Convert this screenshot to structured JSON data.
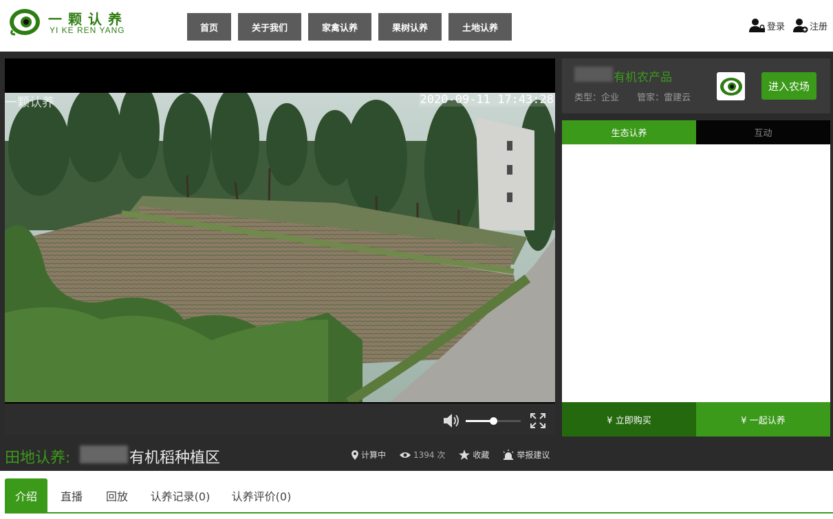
{
  "header": {
    "logo_cn": "一颗认养",
    "logo_en": "YI KE REN YANG",
    "nav": [
      "首页",
      "关于我们",
      "家禽认养",
      "果树认养",
      "土地认养"
    ],
    "login": "登录",
    "register": "注册"
  },
  "video": {
    "osd_watermark": "一颗认养",
    "osd_timestamp": "2020-09-11 17:43:28",
    "volume_level": 0.5
  },
  "farm": {
    "name": "有机农产品",
    "type": "类型：企业",
    "manager": "管家：雷建云",
    "enter_button": "进入农场"
  },
  "side_tabs": [
    "生态认养",
    "互动"
  ],
  "buy": {
    "buy_now": "¥ 立即购买",
    "adopt_together": "¥ 一起认养"
  },
  "title": {
    "category": "田地认养:",
    "name": "有机稻种植区",
    "location": "计算中",
    "views": "1394 次",
    "favorite": "收藏",
    "report": "举报建议"
  },
  "bottom_tabs": [
    "介绍",
    "直播",
    "回放",
    "认养记录(0)",
    "认养评价(0)"
  ],
  "colors": {
    "brand_green": "#3c9a1a",
    "dark_green": "#25690f",
    "nav_gray": "#5b5b5b"
  }
}
